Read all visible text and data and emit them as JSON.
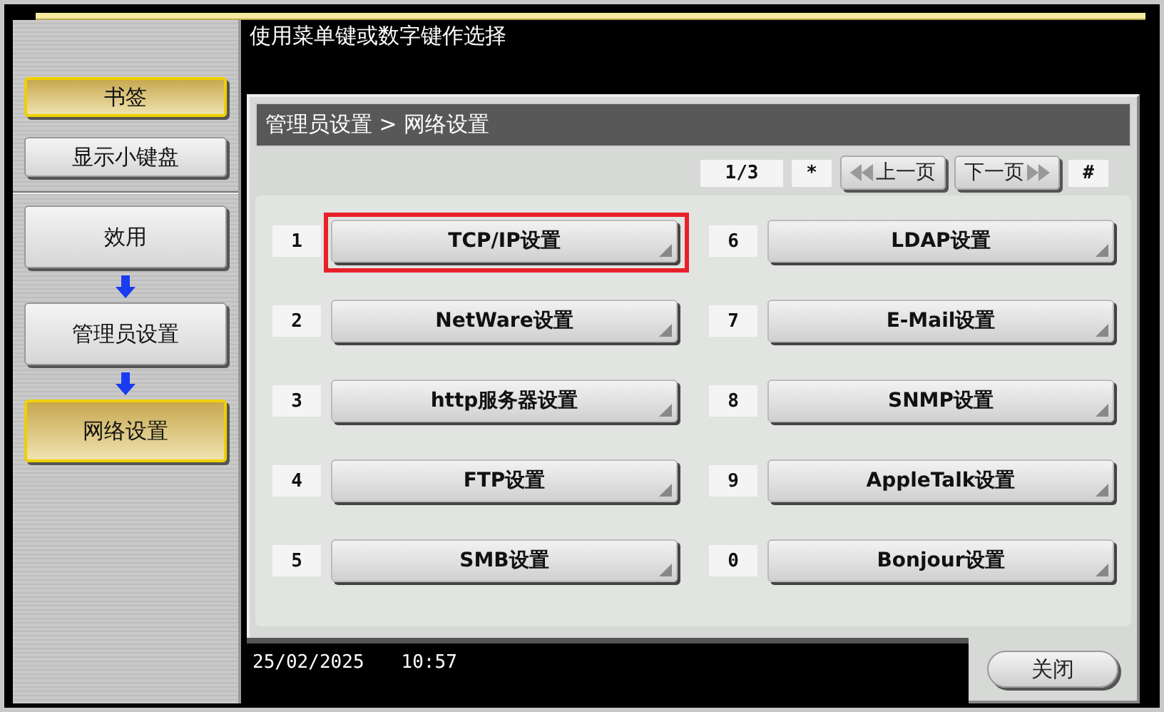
{
  "header": {
    "instruction": "使用菜单键或数字键作选择"
  },
  "sidebar": {
    "items": [
      {
        "label": "书签",
        "selected": true,
        "kind": "button"
      },
      {
        "label": "显示小键盘",
        "selected": false,
        "kind": "button"
      },
      {
        "kind": "divider"
      },
      {
        "label": "效用",
        "selected": false,
        "kind": "step"
      },
      {
        "label": "管理员设置",
        "selected": false,
        "kind": "step"
      },
      {
        "label": "网络设置",
        "selected": true,
        "kind": "step"
      }
    ]
  },
  "panel": {
    "breadcrumb": "管理员设置 > 网络设置",
    "pager": {
      "page": "1/3",
      "prev_key": "*",
      "prev": "上一页",
      "next": "下一页",
      "next_key": "#"
    },
    "items": [
      {
        "key": "1",
        "label": "TCP/IP设置",
        "highlighted": true
      },
      {
        "key": "2",
        "label": "NetWare设置",
        "highlighted": false
      },
      {
        "key": "3",
        "label": "http服务器设置",
        "highlighted": false
      },
      {
        "key": "4",
        "label": "FTP设置",
        "highlighted": false
      },
      {
        "key": "5",
        "label": "SMB设置",
        "highlighted": false
      },
      {
        "key": "6",
        "label": "LDAP设置",
        "highlighted": false
      },
      {
        "key": "7",
        "label": "E-Mail设置",
        "highlighted": false
      },
      {
        "key": "8",
        "label": "SNMP设置",
        "highlighted": false
      },
      {
        "key": "9",
        "label": "AppleTalk设置",
        "highlighted": false
      },
      {
        "key": "0",
        "label": "Bonjour设置",
        "highlighted": false
      }
    ]
  },
  "status_bar": {
    "date": "25/02/2025",
    "time": "10:57"
  },
  "close_button": "关闭"
}
